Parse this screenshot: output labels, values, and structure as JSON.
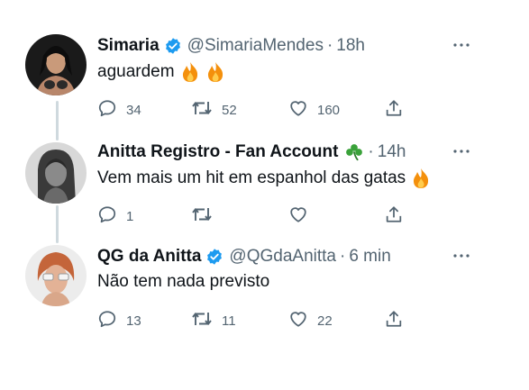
{
  "tweets": [
    {
      "name": "Simaria",
      "handle": "@SimariaMendes",
      "separator": "·",
      "time": "18h",
      "text": "aguardem",
      "replies": "34",
      "retweets": "52",
      "likes": "160",
      "name_badge": "verified-badge",
      "text_emojis": [
        "fire-emoji",
        "fire-emoji"
      ]
    },
    {
      "name": "Anitta Registro - Fan Account",
      "handle": "",
      "separator": "·",
      "time": "14h",
      "text": "Vem mais um hit em espanhol das gatas",
      "replies": "1",
      "retweets": "",
      "likes": "",
      "name_badge": "shamrock-emoji",
      "text_emojis": [
        "fire-emoji"
      ]
    },
    {
      "name": "QG da Anitta",
      "handle": "@QGdaAnitta",
      "separator": "·",
      "time": "6 min",
      "text": "Não tem nada previsto",
      "replies": "13",
      "retweets": "11",
      "likes": "22",
      "name_badge": "verified-badge",
      "text_emojis": []
    }
  ],
  "colors": {
    "text": "#0f1419",
    "secondary": "#536471",
    "verified": "#1d9bf0",
    "thread_line": "#cfd9de",
    "shamrock": "#3aa23a",
    "fire": "#f4900c"
  }
}
